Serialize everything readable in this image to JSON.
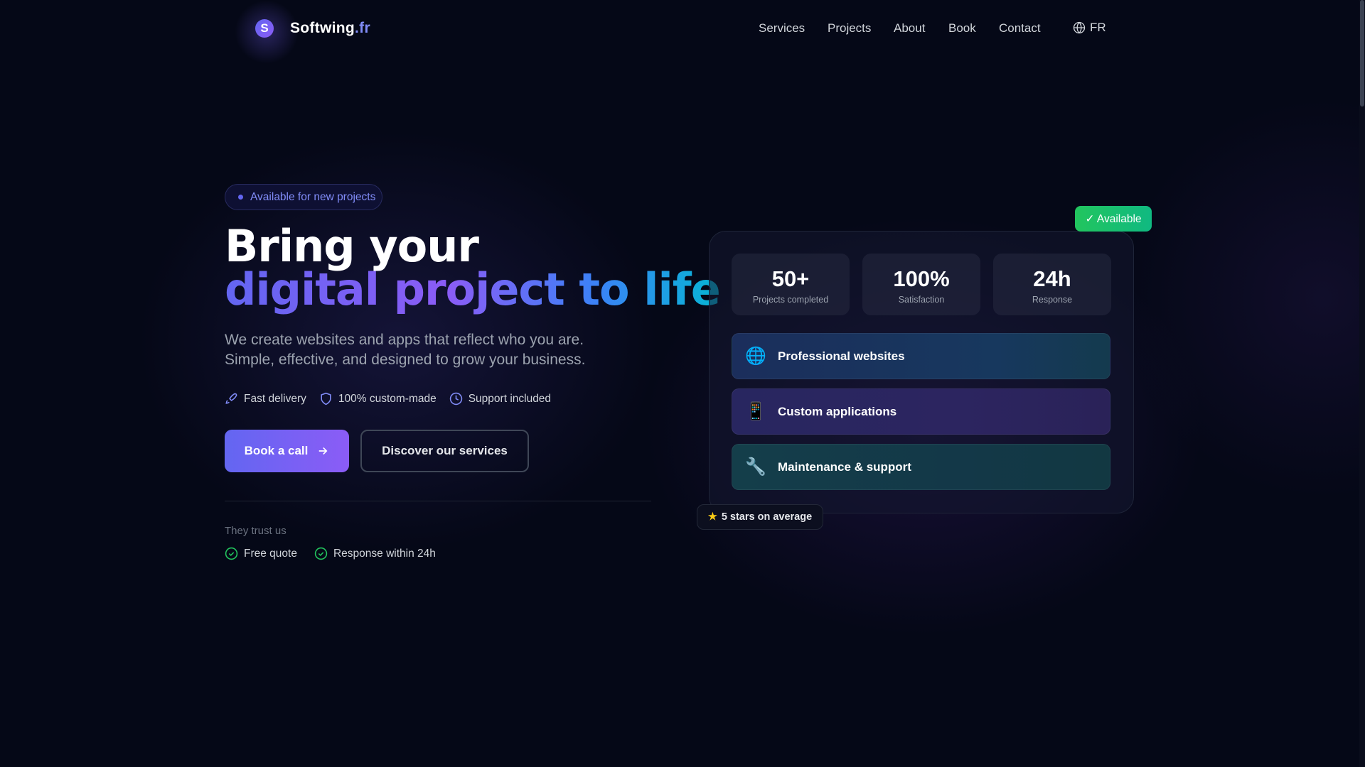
{
  "brand": {
    "name": "Softwing",
    "tld": ".fr"
  },
  "nav": {
    "items": [
      "Services",
      "Projects",
      "About",
      "Book",
      "Contact"
    ],
    "lang": "FR"
  },
  "hero": {
    "badge": "Available for new projects",
    "title_line1": "Bring your",
    "title_line2": "digital project to life",
    "lead_line1": "We create websites and apps that reflect who you are.",
    "lead_line2": "Simple, effective, and designed to grow your business.",
    "features": [
      "Fast delivery",
      "100% custom-made",
      "Support included"
    ],
    "primary_cta": "Book a call",
    "secondary_cta": "Discover our services",
    "trust_title": "They trust us",
    "trust_items": [
      "Free quote",
      "Response within 24h"
    ]
  },
  "card": {
    "available": "✓ Available",
    "stats": [
      {
        "value": "50+",
        "label": "Projects completed"
      },
      {
        "value": "100%",
        "label": "Satisfaction"
      },
      {
        "value": "24h",
        "label": "Response"
      }
    ],
    "services": [
      {
        "icon": "🌐",
        "label": "Professional websites"
      },
      {
        "icon": "📱",
        "label": "Custom applications"
      },
      {
        "icon": "🔧",
        "label": "Maintenance & support"
      }
    ],
    "rating": "5 stars on average"
  },
  "colors": {
    "accent": "#6366f1",
    "accent2": "#8b5cf6",
    "success": "#22c55e",
    "background": "#050817"
  }
}
